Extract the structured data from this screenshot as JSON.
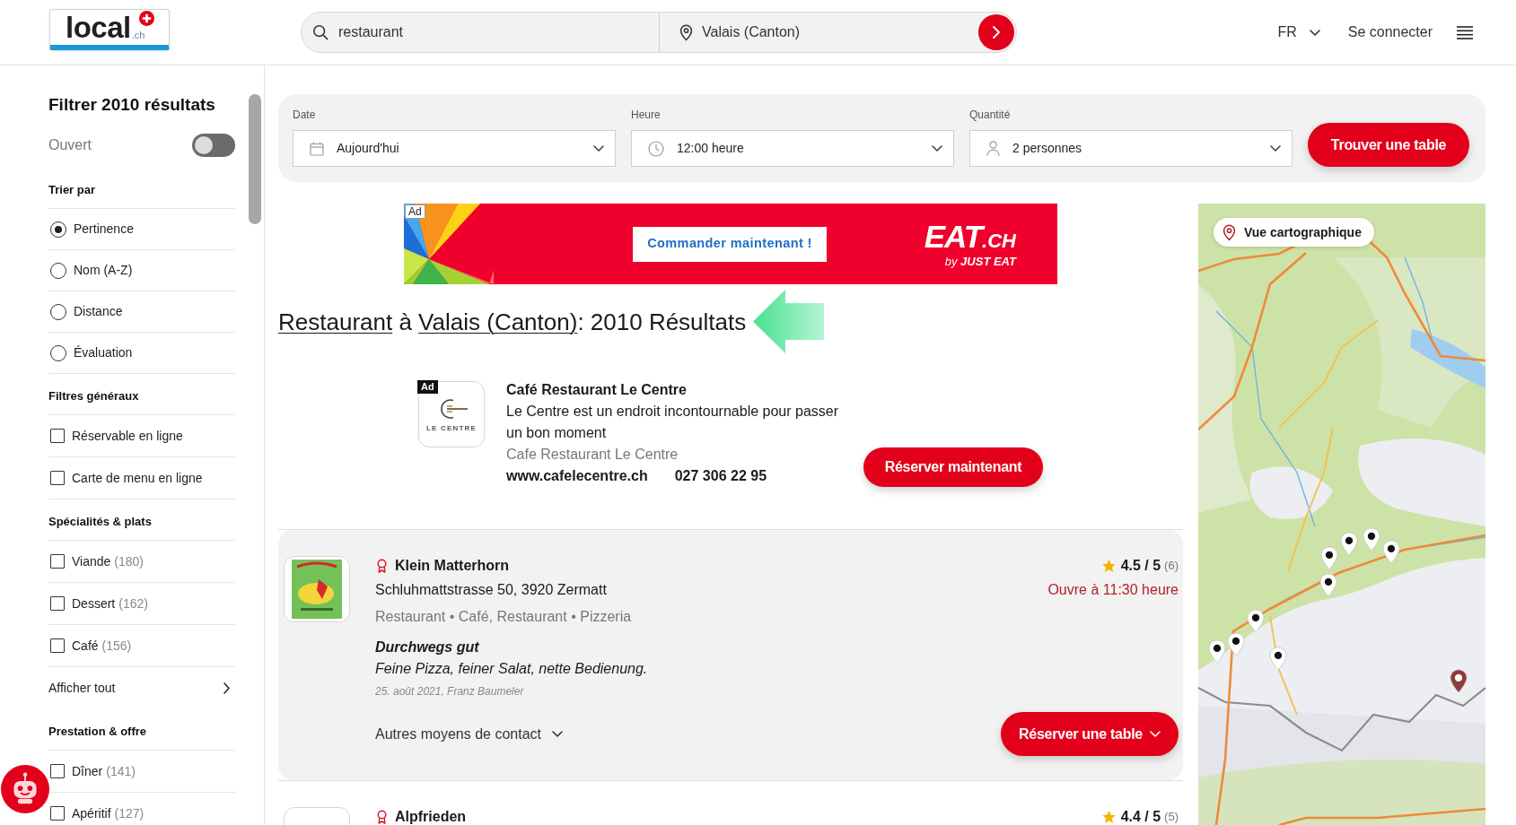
{
  "header": {
    "logo": {
      "name": "local",
      "suffix": ".ch"
    },
    "search": {
      "query": "restaurant",
      "location": "Valais (Canton)"
    },
    "language": "FR",
    "login": "Se connecter"
  },
  "sidebar": {
    "title": "Filtrer 2010 résultats",
    "open_toggle": {
      "label": "Ouvert",
      "on": false
    },
    "sections": [
      {
        "title": "Trier par",
        "kind": "radio",
        "options": [
          {
            "label": "Pertinence",
            "selected": true
          },
          {
            "label": "Nom (A-Z)",
            "selected": false
          },
          {
            "label": "Distance",
            "selected": false
          },
          {
            "label": "Évaluation",
            "selected": false
          }
        ]
      },
      {
        "title": "Filtres généraux",
        "kind": "checkbox",
        "options": [
          {
            "label": "Réservable en ligne",
            "checked": false
          },
          {
            "label": "Carte de menu en ligne",
            "checked": false
          }
        ]
      },
      {
        "title": "Spécialités & plats",
        "kind": "checkbox",
        "options": [
          {
            "label": "Viande",
            "count": "(180)",
            "checked": false
          },
          {
            "label": "Dessert",
            "count": "(162)",
            "checked": false
          },
          {
            "label": "Café",
            "count": "(156)",
            "checked": false
          }
        ],
        "show_all": "Afficher tout"
      },
      {
        "title": "Prestation & offre",
        "kind": "checkbox",
        "options": [
          {
            "label": "Dîner",
            "count": "(141)",
            "checked": false
          },
          {
            "label": "Apéritif",
            "count": "(127)",
            "checked": false
          }
        ]
      }
    ]
  },
  "booking_bar": {
    "fields": [
      {
        "kind": "date",
        "label": "Date",
        "value": "Aujourd'hui"
      },
      {
        "kind": "time",
        "label": "Heure",
        "value": "12:00 heure"
      },
      {
        "kind": "people",
        "label": "Quantité",
        "value": "2 personnes"
      }
    ],
    "button": "Trouver une table"
  },
  "ad_banner": {
    "tag": "Ad",
    "button": "Commander maintenant !",
    "brand": "EAT",
    "brand_suffix": ".CH",
    "tagline": "by **JUST EAT**"
  },
  "results_heading": {
    "query": "Restaurant",
    "connector": "à",
    "location": "Valais (Canton)",
    "summary": ": 2010 Résultats"
  },
  "sponsored": {
    "tag": "Ad",
    "logo_text": "LE CENTRE",
    "name": "Café Restaurant Le Centre",
    "description": "Le Centre est un endroit incontournable pour passer un bon moment",
    "company": "Cafe Restaurant Le Centre",
    "website": "www.cafelecentre.ch",
    "phone": "027 306 22 95",
    "button": "Réserver maintenant"
  },
  "results": [
    {
      "highlighted": true,
      "logo_picture": true,
      "name": "Klein Matterhorn",
      "address": "Schluhmattstrasse 50, 3920 Zermatt",
      "categories": "Restaurant • Café, Restaurant • Pizzeria",
      "rating": "4.5 / 5",
      "rating_count": "(6)",
      "opening": "Ouvre à 11:30 heure",
      "review": {
        "title": "Durchwegs gut",
        "text": "Feine Pizza, feiner Salat, nette Bedienung.",
        "meta": "25. août 2021, Franz Baumeler"
      },
      "contact": "Autres moyens de contact",
      "button": "Réserver une table"
    },
    {
      "highlighted": false,
      "logo_picture": false,
      "name": "Alpfrieden",
      "rating": "4.4 / 5",
      "rating_count": "(5)"
    }
  ],
  "map": {
    "button": "Vue cartographique",
    "pins": [
      {
        "selected": false
      },
      {
        "selected": false
      },
      {
        "selected": false
      },
      {
        "selected": false
      },
      {
        "selected": false
      },
      {
        "selected": false
      },
      {
        "selected": false
      },
      {
        "selected": false
      },
      {
        "selected": false
      },
      {
        "selected": true
      }
    ]
  }
}
